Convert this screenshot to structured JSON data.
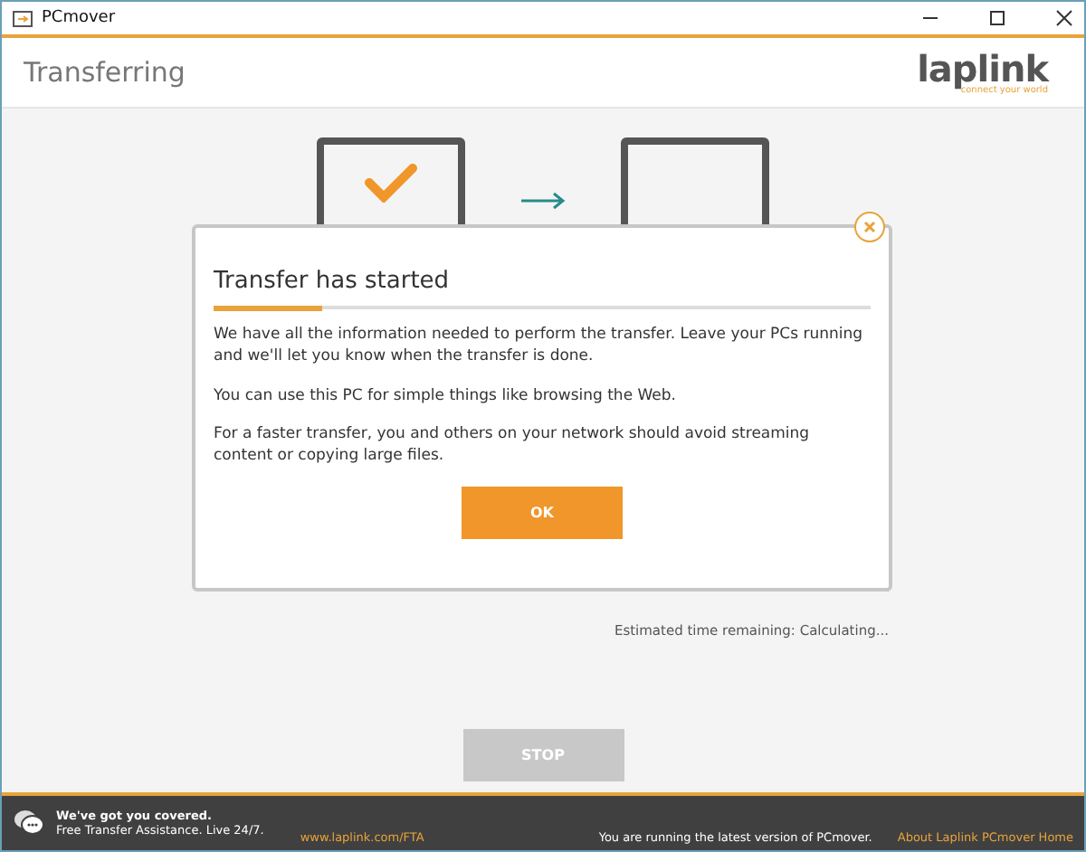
{
  "window": {
    "title": "PCmover"
  },
  "header": {
    "title": "Transferring",
    "logo": "laplink",
    "tagline": "connect your world"
  },
  "transfer": {
    "source_done": true,
    "estimate": "Estimated time remaining: Calculating...",
    "stop_button": {
      "label": "STOP",
      "disabled": true
    }
  },
  "dialog": {
    "title": "Transfer has started",
    "paragraphs": [
      "We have all the information needed to perform the transfer. Leave your PCs running and we'll let you know when the transfer is done.",
      "You can use this PC for simple things like browsing the Web.",
      "For a faster transfer, you and others on your network should avoid streaming content or copying large files."
    ],
    "ok": "OK"
  },
  "footer": {
    "heading": "We've got you covered.",
    "subtext": "Free Transfer Assistance. Live 24/7.",
    "link": "www.laplink.com/FTA",
    "status": "You are running the latest version of PCmover.",
    "about_link": "About Laplink PCmover Home"
  }
}
